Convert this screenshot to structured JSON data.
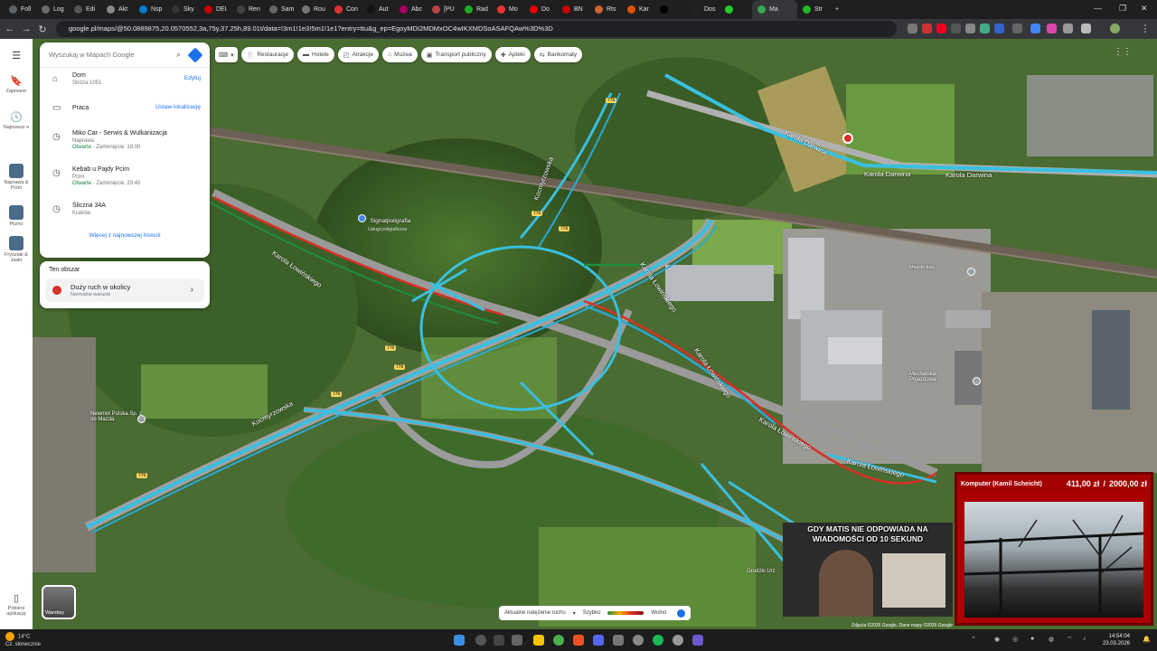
{
  "browser": {
    "tabs": [
      {
        "label": "Foll",
        "color": "#5f6368"
      },
      {
        "label": "Log",
        "color": "#6b6b6b"
      },
      {
        "label": "Edi",
        "color": "#555"
      },
      {
        "label": "Akt",
        "color": "#888"
      },
      {
        "label": "Nsp",
        "color": "#007acc"
      },
      {
        "label": "Sky",
        "color": "#333"
      },
      {
        "label": "DEI",
        "color": "#c00"
      },
      {
        "label": "Ren",
        "color": "#444"
      },
      {
        "label": "Sam",
        "color": "#666"
      },
      {
        "label": "Rou",
        "color": "#777"
      },
      {
        "label": "Con",
        "color": "#d33"
      },
      {
        "label": "Aut",
        "color": "#111"
      },
      {
        "label": "Abc",
        "color": "#a06"
      },
      {
        "label": "[PU",
        "color": "#b44"
      },
      {
        "label": "Rad",
        "color": "#2a2"
      },
      {
        "label": "Mo",
        "color": "#e33"
      },
      {
        "label": "Do",
        "color": "#e00"
      },
      {
        "label": "BN",
        "color": "#c00"
      },
      {
        "label": "Rts",
        "color": "#c63"
      },
      {
        "label": "Kar",
        "color": "#d50"
      },
      {
        "label": "",
        "color": "#000"
      },
      {
        "label": "Dos",
        "color": "#222"
      },
      {
        "label": "",
        "color": "#2c2"
      },
      {
        "label": "Ma",
        "color": "#34a853",
        "active": true
      },
      {
        "label": "Str",
        "color": "#2b2"
      }
    ],
    "new_tab": "+",
    "url": "google.pl/maps/@50.0889875,20.0570552,3a,75y,37.25h,89.01t/data=!3m1!1e3!5m1!1e1?entry=ttu&g_ep=EgoyMDI2MDMxOC4wIKXMDSoASAFQAw%3D%3D"
  },
  "rail": {
    "menu_icon": "menu-icon",
    "saved": "Zapisane",
    "recent": "Najnowsz e",
    "item1": "Naprawa & Pcim",
    "item2": "Pilzno",
    "item3": "Frysztak & Jasło",
    "get_app": "Pobierz aplikację"
  },
  "panel": {
    "search_placeholder": "Wyszukaj w Mapach Google",
    "items": [
      {
        "icon": "home-icon",
        "title": "Dom",
        "sub": "Stróża 1051",
        "action": "Edytuj"
      },
      {
        "icon": "briefcase-icon",
        "title": "Praca",
        "sub": "",
        "action": "Ustaw lokalizację"
      },
      {
        "icon": "history-icon",
        "title": "Miko Car - Serwis & Wulkanizacja",
        "sub": "Naprawa",
        "open": "Otwarte",
        "hours": " · Zamknięcie: 18:00"
      },
      {
        "icon": "history-icon",
        "title": "Kebab u Pajdy Pcim",
        "sub": "Pcim",
        "open": "Otwarte",
        "hours": " · Zamknięcie: 20:45"
      },
      {
        "icon": "history-icon",
        "title": "Śliczna 34A",
        "sub": "Kraków"
      }
    ],
    "more_history": "Więcej z najnowszej historii"
  },
  "area": {
    "title": "Ten obszar",
    "traffic_title": "Duży ruch w okolicy",
    "traffic_sub": "Normalne warunki"
  },
  "chips": [
    "Restauracje",
    "Hotele",
    "Atrakcje",
    "Muzea",
    "Transport publiczny",
    "Apteki",
    "Bankomaty"
  ],
  "map_labels": {
    "road1": "Karola Darwina",
    "road2": "Karola Darwina",
    "road3": "Kocmyrzowska",
    "road4": "Kocmyrzowska",
    "road5": "Karola Łowińskiego",
    "road6": "Karola Łowińskiego",
    "road7": "Karola Łowińskiego",
    "road8": "Karola Łowińskiego",
    "road9": "Karola Łowińskiego",
    "poi1": "Signatpoligrafia",
    "poi1_sub": "Usługi poligraficzne",
    "poi2": "Newmot Polska Sp. z oo Mazda",
    "poi3": "Mechanika Pojazdowa",
    "poi4": "Grodzki Urz",
    "poi5": "Miejski Inst.",
    "route_badge": "776",
    "layers": "Warstwy"
  },
  "legend": {
    "label": "Aktualne natężenie ruchu",
    "fast": "Szybko",
    "slow": "Wolno"
  },
  "copyright": "Zdjęcia ©2026 Google, Dane mapy ©2026 Google",
  "overlay": {
    "name": "Komputer (Kamil Scheicht)",
    "amount": "411,00 zł",
    "separator": "/",
    "goal": "2000,00 zł"
  },
  "camera": {
    "caption": "GDY MATIS NIE ODPOWIADA NA WIADOMOŚCI OD 10 SEKUND"
  },
  "taskbar": {
    "temp": "14°C",
    "weather": "Cz. słonecznie",
    "time": "14:54:04",
    "date": "23.03.2026"
  }
}
